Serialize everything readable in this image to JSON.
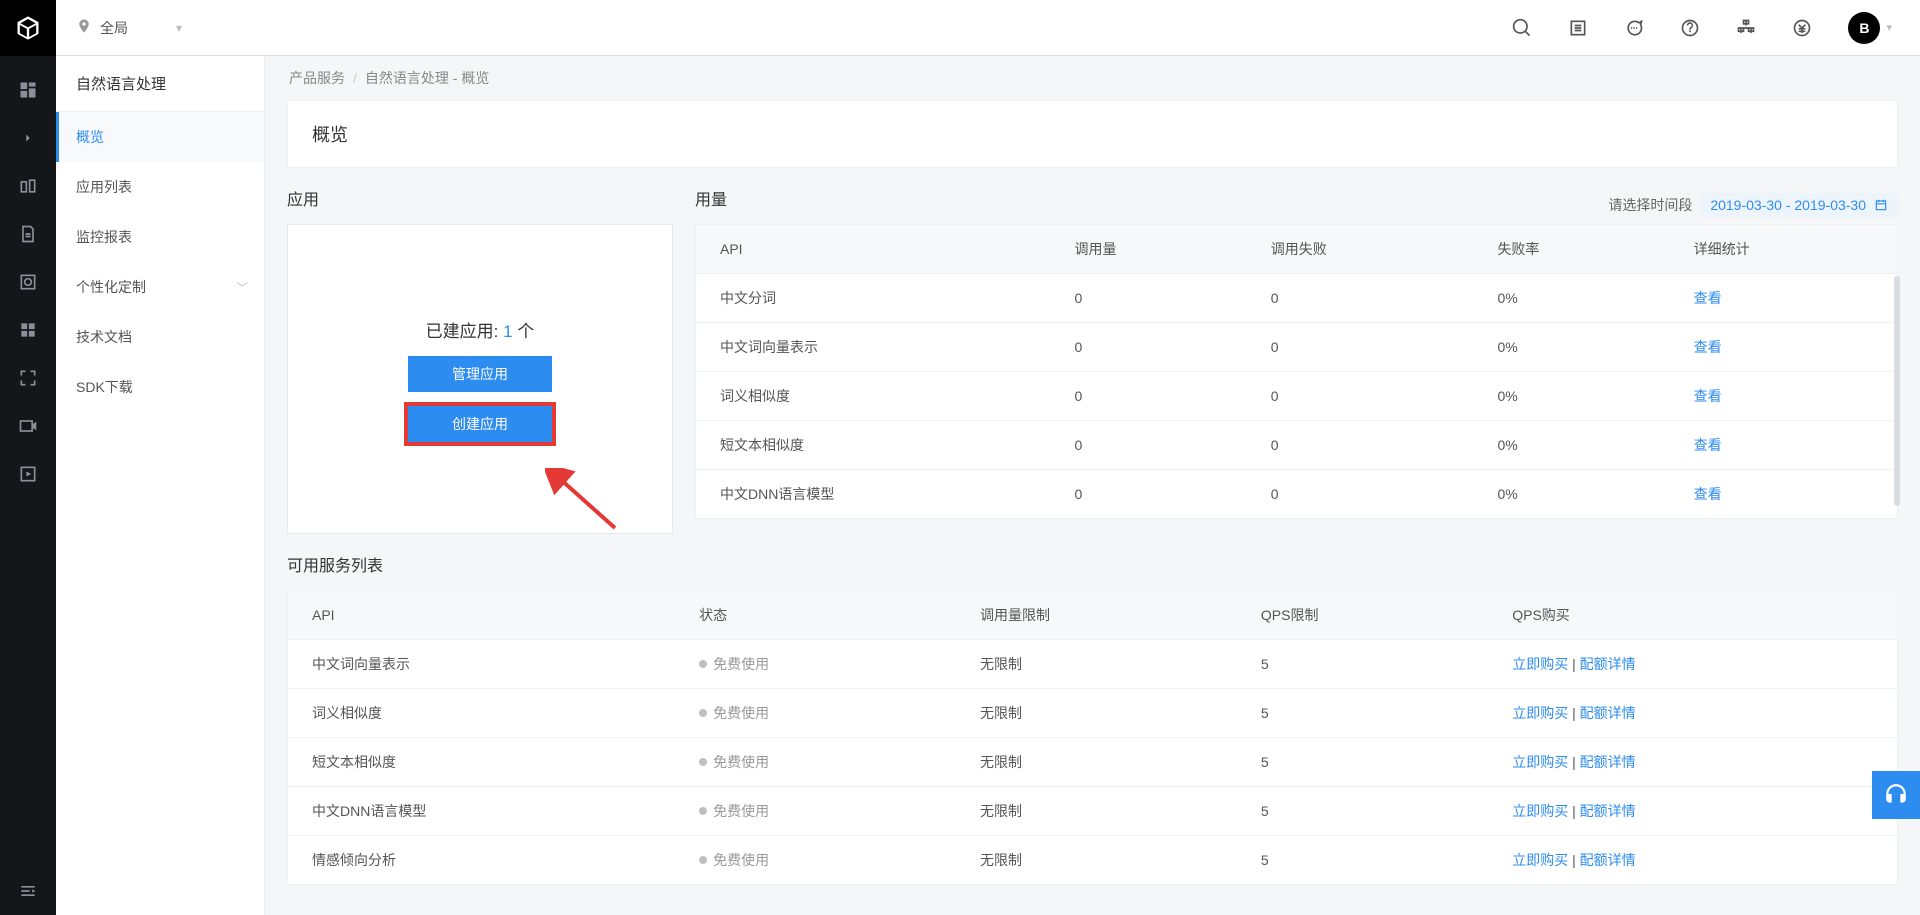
{
  "header": {
    "scope_label": "全局",
    "avatar_letter": "B"
  },
  "sidebar": {
    "title": "自然语言处理",
    "items": [
      {
        "label": "概览",
        "active": true,
        "expandable": false
      },
      {
        "label": "应用列表",
        "active": false,
        "expandable": false
      },
      {
        "label": "监控报表",
        "active": false,
        "expandable": false
      },
      {
        "label": "个性化定制",
        "active": false,
        "expandable": true
      },
      {
        "label": "技术文档",
        "active": false,
        "expandable": false
      },
      {
        "label": "SDK下载",
        "active": false,
        "expandable": false
      }
    ]
  },
  "breadcrumb": {
    "root": "产品服务",
    "current": "自然语言处理 - 概览"
  },
  "page_title": "概览",
  "app_panel": {
    "title": "应用",
    "built_prefix": "已建应用:",
    "built_count": "1",
    "built_suffix": "个",
    "manage_label": "管理应用",
    "create_label": "创建应用"
  },
  "usage_panel": {
    "title": "用量",
    "date_label": "请选择时间段",
    "date_range": "2019-03-30 - 2019-03-30",
    "columns": [
      "API",
      "调用量",
      "调用失败",
      "失败率",
      "详细统计"
    ],
    "view_label": "查看",
    "rows": [
      {
        "api": "中文分词",
        "calls": "0",
        "fails": "0",
        "rate": "0%"
      },
      {
        "api": "中文词向量表示",
        "calls": "0",
        "fails": "0",
        "rate": "0%"
      },
      {
        "api": "词义相似度",
        "calls": "0",
        "fails": "0",
        "rate": "0%"
      },
      {
        "api": "短文本相似度",
        "calls": "0",
        "fails": "0",
        "rate": "0%"
      },
      {
        "api": "中文DNN语言模型",
        "calls": "0",
        "fails": "0",
        "rate": "0%"
      }
    ]
  },
  "services_panel": {
    "title": "可用服务列表",
    "columns": [
      "API",
      "状态",
      "调用量限制",
      "QPS限制",
      "QPS购买"
    ],
    "status_label": "免费使用",
    "buy_label": "立即购买",
    "quota_label": "配额详情",
    "rows": [
      {
        "api": "中文词向量表示",
        "limit": "无限制",
        "qps": "5"
      },
      {
        "api": "词义相似度",
        "limit": "无限制",
        "qps": "5"
      },
      {
        "api": "短文本相似度",
        "limit": "无限制",
        "qps": "5"
      },
      {
        "api": "中文DNN语言模型",
        "limit": "无限制",
        "qps": "5"
      },
      {
        "api": "情感倾向分析",
        "limit": "无限制",
        "qps": "5"
      }
    ]
  }
}
